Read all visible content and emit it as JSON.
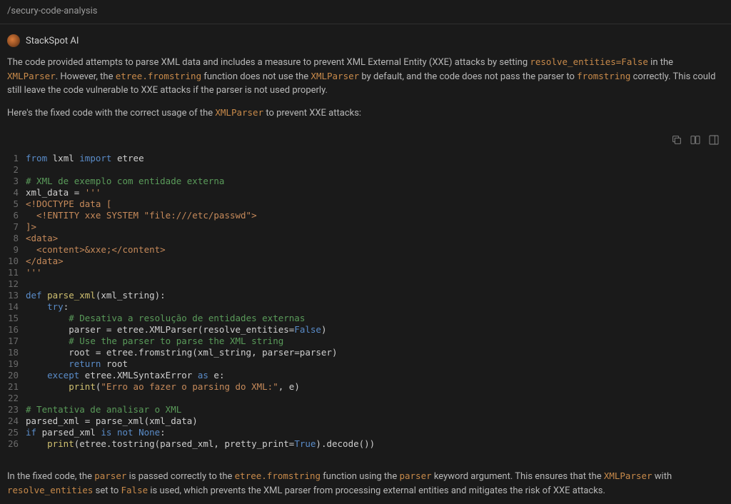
{
  "header": {
    "path": "/secury-code-analysis"
  },
  "agent": {
    "name": "StackSpot AI"
  },
  "explanation": {
    "p1_pre": "The code provided attempts to parse XML data and includes a measure to prevent XML External Entity (XXE) attacks by setting ",
    "code1": "resolve_entities=False",
    "p1_mid1": " in the ",
    "code2": "XMLParser",
    "p1_mid2": ". However, the ",
    "code3": "etree.fromstring",
    "p1_mid3": " function does not use the ",
    "code4": "XMLParser",
    "p1_mid4": " by default, and the code does not pass the parser to ",
    "code5": "fromstring",
    "p1_end": " correctly. This could still leave the code vulnerable to XXE attacks if the parser is not used properly.",
    "p2_pre": "Here's the fixed code with the correct usage of the ",
    "code6": "XMLParser",
    "p2_end": " to prevent XXE attacks:"
  },
  "code": {
    "lines": [
      {
        "n": 1,
        "tokens": [
          {
            "t": "from ",
            "c": "tok-keyword"
          },
          {
            "t": "lxml ",
            "c": "tok-module"
          },
          {
            "t": "import ",
            "c": "tok-keyword"
          },
          {
            "t": "etree",
            "c": "tok-module"
          }
        ]
      },
      {
        "n": 2,
        "tokens": []
      },
      {
        "n": 3,
        "tokens": [
          {
            "t": "# XML de exemplo com entidade externa",
            "c": "tok-comment"
          }
        ]
      },
      {
        "n": 4,
        "tokens": [
          {
            "t": "xml_data = ",
            "c": "tok-module"
          },
          {
            "t": "'''",
            "c": "tok-string"
          }
        ]
      },
      {
        "n": 5,
        "tokens": [
          {
            "t": "<!DOCTYPE data [",
            "c": "tok-string"
          }
        ]
      },
      {
        "n": 6,
        "tokens": [
          {
            "t": "  <!ENTITY xxe SYSTEM \"file:///etc/passwd\">",
            "c": "tok-string"
          }
        ]
      },
      {
        "n": 7,
        "tokens": [
          {
            "t": "]>",
            "c": "tok-string"
          }
        ]
      },
      {
        "n": 8,
        "tokens": [
          {
            "t": "<data>",
            "c": "tok-string"
          }
        ]
      },
      {
        "n": 9,
        "tokens": [
          {
            "t": "  <content>&xxe;</content>",
            "c": "tok-string"
          }
        ]
      },
      {
        "n": 10,
        "tokens": [
          {
            "t": "</data>",
            "c": "tok-string"
          }
        ]
      },
      {
        "n": 11,
        "tokens": [
          {
            "t": "'''",
            "c": "tok-string"
          }
        ]
      },
      {
        "n": 12,
        "tokens": []
      },
      {
        "n": 13,
        "tokens": [
          {
            "t": "def ",
            "c": "tok-keyword"
          },
          {
            "t": "parse_xml",
            "c": "tok-func"
          },
          {
            "t": "(xml_string):",
            "c": "tok-module"
          }
        ]
      },
      {
        "n": 14,
        "tokens": [
          {
            "t": "    ",
            "c": ""
          },
          {
            "t": "try",
            "c": "tok-keyword"
          },
          {
            "t": ":",
            "c": "tok-module"
          }
        ]
      },
      {
        "n": 15,
        "tokens": [
          {
            "t": "        ",
            "c": ""
          },
          {
            "t": "# Desativa a resolução de entidades externas",
            "c": "tok-comment"
          }
        ]
      },
      {
        "n": 16,
        "tokens": [
          {
            "t": "        parser = etree.XMLParser(resolve_entities=",
            "c": "tok-module"
          },
          {
            "t": "False",
            "c": "tok-const"
          },
          {
            "t": ")",
            "c": "tok-module"
          }
        ]
      },
      {
        "n": 17,
        "tokens": [
          {
            "t": "        ",
            "c": ""
          },
          {
            "t": "# Use the parser to parse the XML string",
            "c": "tok-comment"
          }
        ]
      },
      {
        "n": 18,
        "tokens": [
          {
            "t": "        root = etree.fromstring(xml_string, parser=parser)",
            "c": "tok-module"
          }
        ]
      },
      {
        "n": 19,
        "tokens": [
          {
            "t": "        ",
            "c": ""
          },
          {
            "t": "return ",
            "c": "tok-keyword"
          },
          {
            "t": "root",
            "c": "tok-module"
          }
        ]
      },
      {
        "n": 20,
        "tokens": [
          {
            "t": "    ",
            "c": ""
          },
          {
            "t": "except ",
            "c": "tok-keyword"
          },
          {
            "t": "etree.XMLSyntaxError ",
            "c": "tok-module"
          },
          {
            "t": "as ",
            "c": "tok-keyword"
          },
          {
            "t": "e:",
            "c": "tok-module"
          }
        ]
      },
      {
        "n": 21,
        "tokens": [
          {
            "t": "        ",
            "c": ""
          },
          {
            "t": "print",
            "c": "tok-func"
          },
          {
            "t": "(",
            "c": "tok-module"
          },
          {
            "t": "\"Erro ao fazer o parsing do XML:\"",
            "c": "tok-string"
          },
          {
            "t": ", e)",
            "c": "tok-module"
          }
        ]
      },
      {
        "n": 22,
        "tokens": []
      },
      {
        "n": 23,
        "tokens": [
          {
            "t": "# Tentativa de analisar o XML",
            "c": "tok-comment"
          }
        ]
      },
      {
        "n": 24,
        "tokens": [
          {
            "t": "parsed_xml = parse_xml(xml_data)",
            "c": "tok-module"
          }
        ]
      },
      {
        "n": 25,
        "tokens": [
          {
            "t": "if ",
            "c": "tok-keyword"
          },
          {
            "t": "parsed_xml ",
            "c": "tok-module"
          },
          {
            "t": "is not ",
            "c": "tok-keyword"
          },
          {
            "t": "None",
            "c": "tok-const"
          },
          {
            "t": ":",
            "c": "tok-module"
          }
        ]
      },
      {
        "n": 26,
        "tokens": [
          {
            "t": "    ",
            "c": ""
          },
          {
            "t": "print",
            "c": "tok-func"
          },
          {
            "t": "(etree.tostring(parsed_xml, pretty_print=",
            "c": "tok-module"
          },
          {
            "t": "True",
            "c": "tok-const"
          },
          {
            "t": ").decode())",
            "c": "tok-module"
          }
        ]
      }
    ]
  },
  "lower": {
    "pre": "In the fixed code, the ",
    "c1": "parser",
    "m1": " is passed correctly to the ",
    "c2": "etree.fromstring",
    "m2": " function using the ",
    "c3": "parser",
    "m3": " keyword argument. This ensures that the ",
    "c4": "XMLParser",
    "m4": " with ",
    "c5": "resolve_entities",
    "m5": " set to ",
    "c6": "False",
    "end": " is used, which prevents the XML parser from processing external entities and mitigates the risk of XXE attacks."
  }
}
